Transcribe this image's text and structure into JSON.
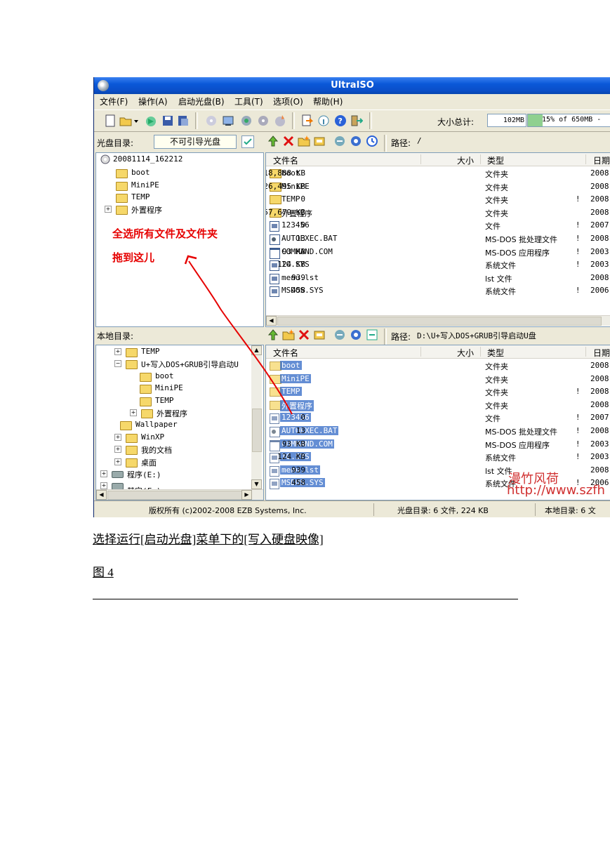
{
  "window": {
    "title": "UltraISO",
    "menu": [
      "文件(F)",
      "操作(A)",
      "启动光盘(B)",
      "工具(T)",
      "选项(O)",
      "帮助(H)"
    ],
    "size_label": "大小总计:",
    "size_value": "102MB",
    "capacity_text": "15% of 650MB - ",
    "capacity_fraction": 0.15
  },
  "iso": {
    "label": "光盘目录:",
    "boot_state": "不可引导光盘",
    "path_label": "路径:",
    "path": "/",
    "tree": [
      "20081114_162212",
      "boot",
      "MiniPE",
      "TEMP",
      "外置程序"
    ],
    "headers": {
      "name": "文件名",
      "size": "大小",
      "type": "类型",
      "date": "日期"
    },
    "files": [
      {
        "name": "boot",
        "size": "18,888 KB",
        "type": "文件夹",
        "flag": "",
        "date": "2008",
        "icon": "folder-icon"
      },
      {
        "name": "MiniPE",
        "size": "26,495 KB",
        "type": "文件夹",
        "flag": "",
        "date": "2008",
        "icon": "folder-icon"
      },
      {
        "name": "TEMP",
        "size": "0",
        "type": "文件夹",
        "flag": "!",
        "date": "2008",
        "icon": "folder-icon"
      },
      {
        "name": "外置程序",
        "size": "57,679 KB",
        "type": "文件夹",
        "flag": "",
        "date": "2008",
        "icon": "folder-icon"
      },
      {
        "name": "123456",
        "size": "0",
        "type": "文件",
        "flag": "!",
        "date": "2007",
        "icon": "file-icon"
      },
      {
        "name": "AUTOEXEC.BAT",
        "size": "13",
        "type": "MS-DOS 批处理文件",
        "flag": "!",
        "date": "2008",
        "icon": "batch-file-icon"
      },
      {
        "name": "COMMAND.COM",
        "size": "93 KB",
        "type": "MS-DOS 应用程序",
        "flag": "!",
        "date": "2003",
        "icon": "app-icon"
      },
      {
        "name": "IO.SYS",
        "size": "124 KB",
        "type": "系统文件",
        "flag": "!",
        "date": "2003",
        "icon": "file-icon"
      },
      {
        "name": "menu.lst",
        "size": "939",
        "type": "lst 文件",
        "flag": "",
        "date": "2008",
        "icon": "file-icon"
      },
      {
        "name": "MSDOS.SYS",
        "size": "458",
        "type": "系统文件",
        "flag": "!",
        "date": "2006",
        "icon": "file-icon"
      }
    ]
  },
  "local": {
    "label": "本地目录:",
    "path_label": "路径:",
    "path": "D:\\U+写入DOS+GRUB引导启动U盘",
    "tree": [
      "TEMP",
      "U+写入DOS+GRUB引导启动U",
      "boot",
      "MiniPE",
      "TEMP",
      "外置程序",
      "Wallpaper",
      "WinXP",
      "我的文档",
      "桌面",
      "程序(E:)",
      "其它(F:)"
    ],
    "headers": {
      "name": "文件名",
      "size": "大小",
      "type": "类型",
      "date": "日期"
    },
    "files": [
      {
        "name": "boot",
        "size": "",
        "type": "文件夹",
        "flag": "",
        "date": "2008",
        "icon": "folder-icon"
      },
      {
        "name": "MiniPE",
        "size": "",
        "type": "文件夹",
        "flag": "",
        "date": "2008",
        "icon": "folder-icon"
      },
      {
        "name": "TEMP",
        "size": "",
        "type": "文件夹",
        "flag": "!",
        "date": "2008",
        "icon": "folder-icon"
      },
      {
        "name": "外置程序",
        "size": "",
        "type": "文件夹",
        "flag": "",
        "date": "2008",
        "icon": "folder-icon"
      },
      {
        "name": "123456",
        "size": "0",
        "type": "文件",
        "flag": "!",
        "date": "2007",
        "icon": "file-icon"
      },
      {
        "name": "AUTOEXEC.BAT",
        "size": "13",
        "type": "MS-DOS 批处理文件",
        "flag": "!",
        "date": "2008",
        "icon": "batch-file-icon"
      },
      {
        "name": "COMMAND.COM",
        "size": "93 KB",
        "type": "MS-DOS 应用程序",
        "flag": "!",
        "date": "2003",
        "icon": "app-icon"
      },
      {
        "name": "IO.SYS",
        "size": "124 KB",
        "type": "系统文件",
        "flag": "!",
        "date": "2003",
        "icon": "file-icon"
      },
      {
        "name": "menu.lst",
        "size": "939",
        "type": "lst 文件",
        "flag": "",
        "date": "2008",
        "icon": "file-icon"
      },
      {
        "name": "MSDOS.SYS",
        "size": "458",
        "type": "系统文件",
        "flag": "!",
        "date": "2006",
        "icon": "file-icon"
      }
    ]
  },
  "status": {
    "copyright": "版权所有 (c)2002-2008 EZB Systems, Inc.",
    "iso_summary": "光盘目录: 6 文件, 224 KB",
    "local_summary": "本地目录: 6 文"
  },
  "annotation": {
    "line1": "全选所有文件及文件夹",
    "line2": "拖到这儿",
    "color": "#e60000"
  },
  "watermark": {
    "line1": "漫竹风荷",
    "line2": "http://www.szfh"
  },
  "captions": {
    "instruction": "选择运行[启动光盘]菜单下的[写入硬盘映像]",
    "figure": "图 4"
  }
}
